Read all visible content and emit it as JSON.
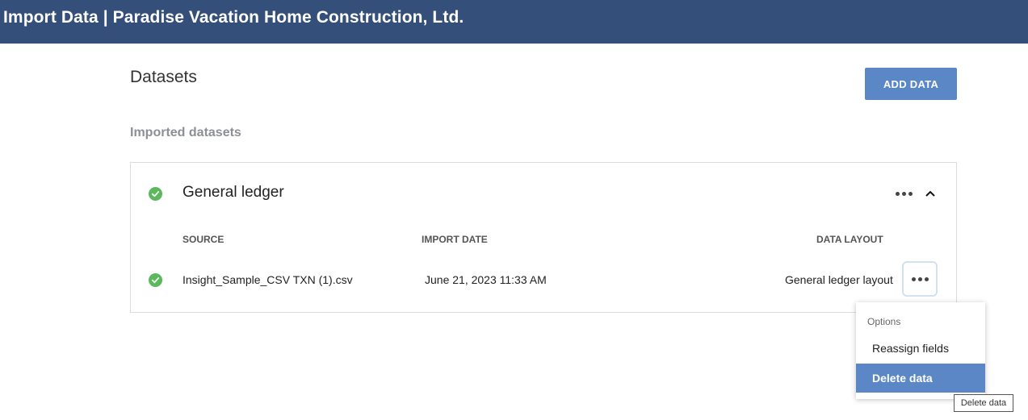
{
  "header": {
    "title": "Import Data | Paradise Vacation Home Construction, Ltd."
  },
  "page": {
    "title": "Datasets",
    "add_button": "ADD DATA",
    "section_label": "Imported datasets"
  },
  "dataset": {
    "title": "General ledger",
    "status": "success",
    "columns": {
      "source": "SOURCE",
      "import_date": "IMPORT DATE",
      "data_layout": "DATA LAYOUT"
    },
    "rows": [
      {
        "source": "Insight_Sample_CSV TXN (1).csv",
        "import_date": "June 21, 2023 11:33 AM",
        "data_layout": "General ledger layout",
        "status": "success"
      }
    ]
  },
  "options_menu": {
    "label": "Options",
    "items": [
      {
        "label": "Reassign fields"
      },
      {
        "label": "Delete data",
        "highlighted": true
      }
    ]
  },
  "tooltip": {
    "text": "Delete data"
  },
  "colors": {
    "header_bg": "#344f79",
    "accent": "#5b87c7",
    "success": "#5cb85c"
  }
}
